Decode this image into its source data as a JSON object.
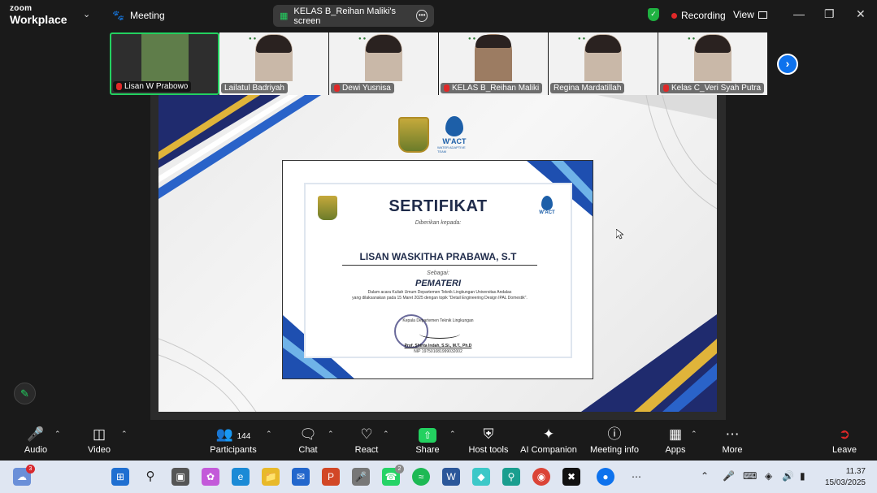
{
  "topbar": {
    "brand_top": "zoom",
    "brand_bottom": "Workplace",
    "meeting_label": "Meeting",
    "share_label": "KELAS B_Reihan Maliki's screen",
    "recording_label": "Recording",
    "view_label": "View"
  },
  "participants": [
    {
      "name": "Lisan W Prabowo"
    },
    {
      "name": "Lailatul Badriyah"
    },
    {
      "name": "Dewi Yusnisa"
    },
    {
      "name": "KELAS B_Reihan Maliki"
    },
    {
      "name": "Regina Mardatillah"
    },
    {
      "name": "Kelas C_Veri Syah Putra"
    }
  ],
  "slide": {
    "wact_logo": "W'ACT",
    "wact_sub": "WATER ADAPTIVE TEAM",
    "certificate": {
      "title": "SERTIFIKAT",
      "given_to": "Diberikan kepada:",
      "name": "LISAN WASKITHA PRABAWA, S.T",
      "as_label": "Sebagai:",
      "role": "PEMATERI",
      "desc_1": "Dalam acara Kuliah Umum Departemen Teknik Lingkungan Universitas Andalas",
      "desc_2": "yang dilaksanakan pada 15 Maret 2025 dengan topik \"Detail Engineering Design IPAL Domestik\".",
      "dept": "Kepala Departemen Teknik Lingkungan",
      "signer": "Prof. Shinta Indah, S.Si., M.T., Ph.D",
      "nip": "NIP 197501081999032002"
    }
  },
  "toolbar": {
    "audio": "Audio",
    "video": "Video",
    "participants_count": "144",
    "participants": "Participants",
    "chat": "Chat",
    "react": "React",
    "share": "Share",
    "host_tools": "Host tools",
    "ai_companion": "AI Companion",
    "meeting_info": "Meeting info",
    "apps": "Apps",
    "more": "More",
    "leave": "Leave"
  },
  "taskbar": {
    "weather_badge": "3",
    "whatsapp_badge": "2",
    "time": "11.37",
    "date": "15/03/2025"
  },
  "colors": {
    "accent_green": "#23d160",
    "zoom_blue": "#0e72ed",
    "record_red": "#e02828",
    "cert_navy": "#1f2b4a"
  }
}
